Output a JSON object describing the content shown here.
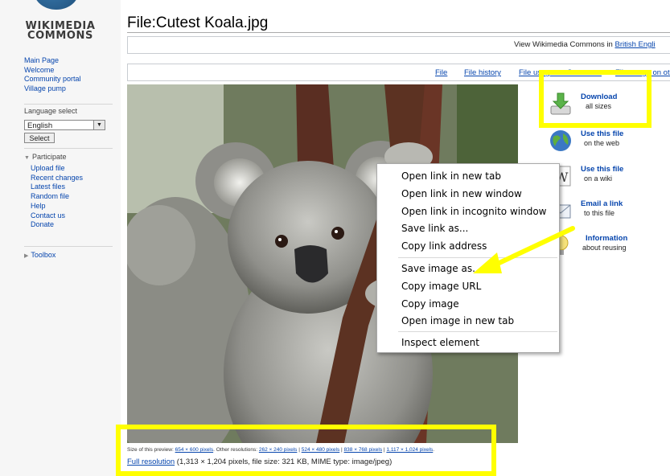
{
  "logo": {
    "line1": "WIKIMEDIA",
    "line2": "COMMONS"
  },
  "sidebar": {
    "nav": [
      "Main Page",
      "Welcome",
      "Community portal",
      "Village pump"
    ],
    "language_label": "Language select",
    "language_value": "English",
    "select_button": "Select",
    "participate_label": "Participate",
    "participate_items": [
      "Upload file",
      "Recent changes",
      "Latest files",
      "Random file",
      "Help",
      "Contact us",
      "Donate"
    ],
    "toolbox_label": "Toolbox"
  },
  "page_title": "File:Cutest Koala.jpg",
  "notice": {
    "text": "View Wikimedia Commons in ",
    "link": "British Engli"
  },
  "tabs": [
    "File",
    "File history",
    "File usage on Commons",
    "File usage on oth"
  ],
  "tools": [
    {
      "title": "Download",
      "sub": "all sizes",
      "icon": "download-icon"
    },
    {
      "title": "Use this file",
      "sub": "on the web",
      "icon": "globe-icon"
    },
    {
      "title": "Use this file",
      "sub": "on a wiki",
      "icon": "wiki-icon"
    },
    {
      "title": "Email a link",
      "sub": "to this file",
      "icon": "email-icon"
    },
    {
      "title": "Information",
      "sub": "about reusing",
      "icon": "lightbulb-icon"
    }
  ],
  "context_menu": {
    "items": [
      "Open link in new tab",
      "Open link in new window",
      "Open link in incognito window",
      "Save link as...",
      "Copy link address",
      "Save image as...",
      "Copy image URL",
      "Copy image",
      "Open image in new tab",
      "Inspect element"
    ]
  },
  "size_info": {
    "prefix": "Size of this preview: ",
    "preview": "654 × 600 pixels",
    "mid": ". Other resolutions: ",
    "r1": "262 × 240 pixels",
    "r2": "524 × 480 pixels",
    "r3": "838 × 768 pixels",
    "r4": "1,117 × 1,024 pixels",
    "sep": " | ",
    "end": "."
  },
  "full_res": {
    "link": "Full resolution",
    "details": " (1,313 × 1,204 pixels, file size: 321 KB, MIME type: image/jpeg)"
  },
  "colors": {
    "highlight": "#ffff00",
    "link": "#0645ad",
    "arrow": "#ffff00"
  }
}
